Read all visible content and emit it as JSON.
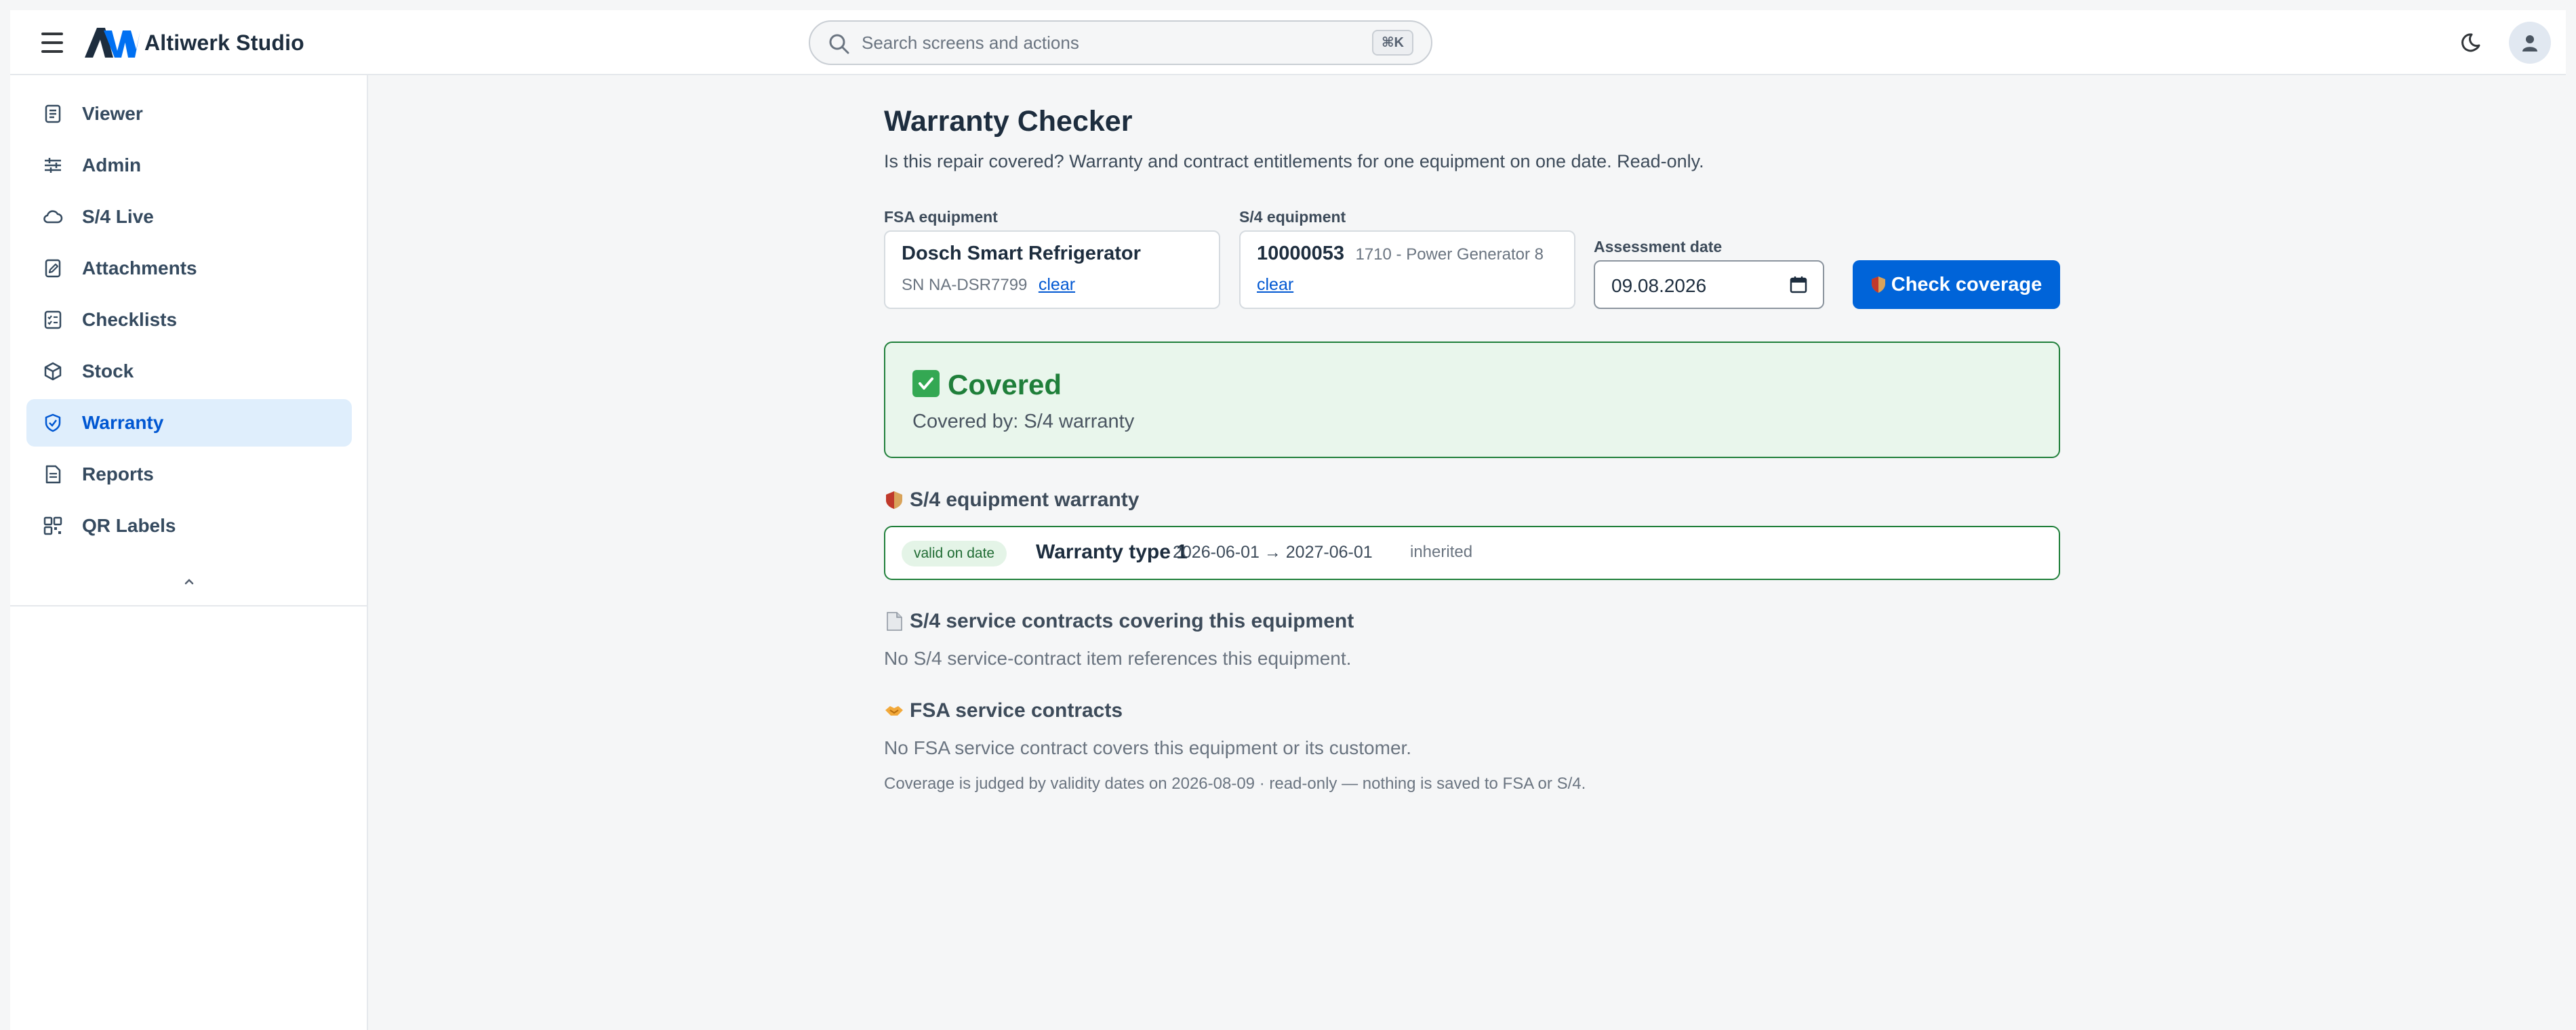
{
  "header": {
    "app_name": "Altiwerk Studio",
    "search": {
      "placeholder": "Search screens and actions",
      "shortcut": "⌘K"
    }
  },
  "sidebar": {
    "items": [
      {
        "label": "Viewer",
        "icon": "document-icon",
        "active": false
      },
      {
        "label": "Admin",
        "icon": "sliders-icon",
        "active": false
      },
      {
        "label": "S/4 Live",
        "icon": "cloud-icon",
        "active": false
      },
      {
        "label": "Attachments",
        "icon": "edit-document-icon",
        "active": false
      },
      {
        "label": "Checklists",
        "icon": "checklist-icon",
        "active": false
      },
      {
        "label": "Stock",
        "icon": "box-icon",
        "active": false
      },
      {
        "label": "Warranty",
        "icon": "shield-check-icon",
        "active": true
      },
      {
        "label": "Reports",
        "icon": "report-icon",
        "active": false
      },
      {
        "label": "QR Labels",
        "icon": "qr-code-icon",
        "active": false
      }
    ]
  },
  "main": {
    "title": "Warranty Checker",
    "subtitle": "Is this repair covered? Warranty and contract entitlements for one equipment on one date. Read-only.",
    "fsa_equipment": {
      "label": "FSA equipment",
      "name": "Dosch Smart Refrigerator",
      "serial": "SN NA-DSR7799",
      "clear_label": "clear"
    },
    "s4_equipment": {
      "label": "S/4 equipment",
      "number": "10000053",
      "description": "1710 - Power Generator 8",
      "clear_label": "clear"
    },
    "assessment_date": {
      "label": "Assessment date",
      "value": "09.08.2026"
    },
    "check_button_label": "Check coverage",
    "result": {
      "status": "Covered",
      "detail": "Covered by: S/4 warranty"
    },
    "s4_warranty": {
      "heading": "S/4 equipment warranty",
      "badge": "valid on date",
      "type": "Warranty type 1",
      "dates": "2026-06-01 → 2027-06-01",
      "inherited": "inherited"
    },
    "s4_contracts": {
      "heading": "S/4 service contracts covering this equipment",
      "empty": "No S/4 service-contract item references this equipment."
    },
    "fsa_contracts": {
      "heading": "FSA service contracts",
      "empty": "No FSA service contract covers this equipment or its customer."
    },
    "footnote": "Coverage is judged by validity dates on 2026-08-09 · read-only — nothing is saved to FSA or S/4."
  },
  "colors": {
    "brand_primary": "#0064d9",
    "active_nav_bg": "#dfeefc",
    "covered_green": "#1f7f3a",
    "covered_bg": "#e9f6ec"
  }
}
